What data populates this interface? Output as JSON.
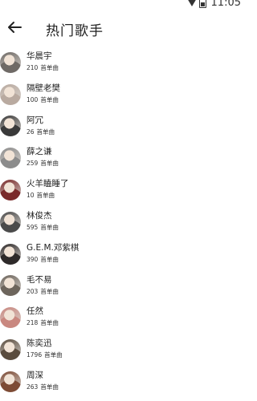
{
  "status_bar": {
    "time": "11:05",
    "icons": [
      "signal-icon",
      "battery-icon"
    ]
  },
  "header": {
    "back_icon": "arrow-left-icon",
    "title": "热门歌手"
  },
  "count_suffix": "首单曲",
  "singers": [
    {
      "name": "华晨宇",
      "count": "210",
      "avatar_color": "#6f6a66"
    },
    {
      "name": "隔壁老樊",
      "count": "100",
      "avatar_color": "#b9aaa0"
    },
    {
      "name": "阿冗",
      "count": "26",
      "avatar_color": "#3a3a3a"
    },
    {
      "name": "薛之谦",
      "count": "259",
      "avatar_color": "#8c8c8c"
    },
    {
      "name": "火羊瞌睡了",
      "count": "10",
      "avatar_color": "#7a2a2a"
    },
    {
      "name": "林俊杰",
      "count": "595",
      "avatar_color": "#4b4b4b"
    },
    {
      "name": "G.E.M.邓紫棋",
      "count": "390",
      "avatar_color": "#2e2a2a"
    },
    {
      "name": "毛不易",
      "count": "203",
      "avatar_color": "#6d655c"
    },
    {
      "name": "任然",
      "count": "218",
      "avatar_color": "#c98880"
    },
    {
      "name": "陈奕迅",
      "count": "1796",
      "avatar_color": "#5a4c3e"
    },
    {
      "name": "周深",
      "count": "263",
      "avatar_color": "#7d4b35"
    }
  ]
}
